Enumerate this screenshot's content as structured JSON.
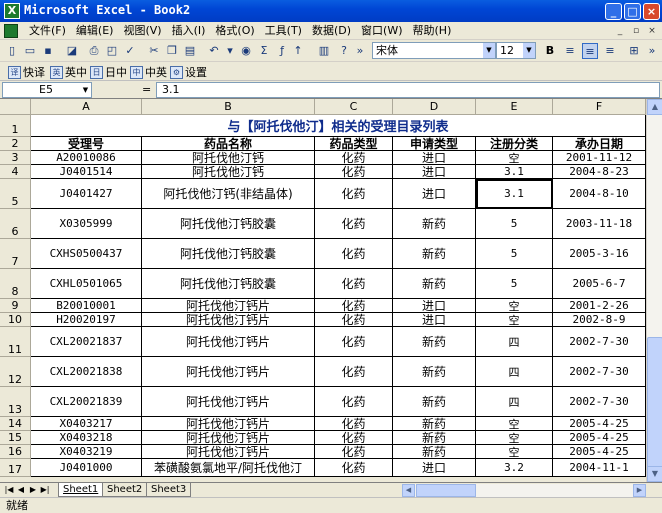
{
  "window": {
    "title": "Microsoft Excel - Book2",
    "app_icon": "excel-icon"
  },
  "menu": [
    "文件(F)",
    "编辑(E)",
    "视图(V)",
    "插入(I)",
    "格式(O)",
    "工具(T)",
    "数据(D)",
    "窗口(W)",
    "帮助(H)"
  ],
  "toolbar": {
    "font_name": "宋体",
    "font_size": "12",
    "bold_label": "B"
  },
  "ime": {
    "kuaiyi": "快译",
    "yingzhong": "英中",
    "rizhong": "日中",
    "zhongying": "中英",
    "shezhi": "设置"
  },
  "formula": {
    "name_box": "E5",
    "equals": "=",
    "value": "3.1"
  },
  "columns": [
    "A",
    "B",
    "C",
    "D",
    "E",
    "F"
  ],
  "sheet": {
    "title": "与【阿托伐他汀】相关的受理目录列表",
    "headers": [
      "受理号",
      "药品名称",
      "药品类型",
      "申请类型",
      "注册分类",
      "承办日期"
    ],
    "rows": [
      {
        "row": "3",
        "cells": [
          "A20010086",
          "阿托伐他汀钙",
          "化药",
          "进口",
          "空",
          "2001-11-12"
        ]
      },
      {
        "row": "4",
        "cells": [
          "J0401514",
          "阿托伐他汀钙",
          "化药",
          "进口",
          "3.1",
          "2004-8-23"
        ]
      },
      {
        "row": "5",
        "cells": [
          "J0401427",
          "阿托伐他汀钙(非结晶体)",
          "化药",
          "进口",
          "3.1",
          "2004-8-10"
        ]
      },
      {
        "row": "6",
        "cells": [
          "X0305999",
          "阿托伐他汀钙胶囊",
          "化药",
          "新药",
          "5",
          "2003-11-18"
        ]
      },
      {
        "row": "7",
        "cells": [
          "CXHS0500437",
          "阿托伐他汀钙胶囊",
          "化药",
          "新药",
          "5",
          "2005-3-16"
        ]
      },
      {
        "row": "8",
        "cells": [
          "CXHL0501065",
          "阿托伐他汀钙胶囊",
          "化药",
          "新药",
          "5",
          "2005-6-7"
        ]
      },
      {
        "row": "9",
        "cells": [
          "B20010001",
          "阿托伐他汀钙片",
          "化药",
          "进口",
          "空",
          "2001-2-26"
        ]
      },
      {
        "row": "10",
        "cells": [
          "H20020197",
          "阿托伐他汀钙片",
          "化药",
          "进口",
          "空",
          "2002-8-9"
        ]
      },
      {
        "row": "11",
        "cells": [
          "CXL20021837",
          "阿托伐他汀钙片",
          "化药",
          "新药",
          "四",
          "2002-7-30"
        ]
      },
      {
        "row": "12",
        "cells": [
          "CXL20021838",
          "阿托伐他汀钙片",
          "化药",
          "新药",
          "四",
          "2002-7-30"
        ]
      },
      {
        "row": "13",
        "cells": [
          "CXL20021839",
          "阿托伐他汀钙片",
          "化药",
          "新药",
          "四",
          "2002-7-30"
        ]
      },
      {
        "row": "14",
        "cells": [
          "X0403217",
          "阿托伐他汀钙片",
          "化药",
          "新药",
          "空",
          "2005-4-25"
        ]
      },
      {
        "row": "15",
        "cells": [
          "X0403218",
          "阿托伐他汀钙片",
          "化药",
          "新药",
          "空",
          "2005-4-25"
        ]
      },
      {
        "row": "16",
        "cells": [
          "X0403219",
          "阿托伐他汀钙片",
          "化药",
          "新药",
          "空",
          "2005-4-25"
        ]
      },
      {
        "row": "17",
        "cells": [
          "J0401000",
          "苯磺酸氨氯地平/阿托伐他汀",
          "化药",
          "进口",
          "3.2",
          "2004-11-1"
        ]
      }
    ]
  },
  "sheets": [
    "Sheet1",
    "Sheet2",
    "Sheet3"
  ],
  "status": "就绪",
  "selected_cell": "E5"
}
